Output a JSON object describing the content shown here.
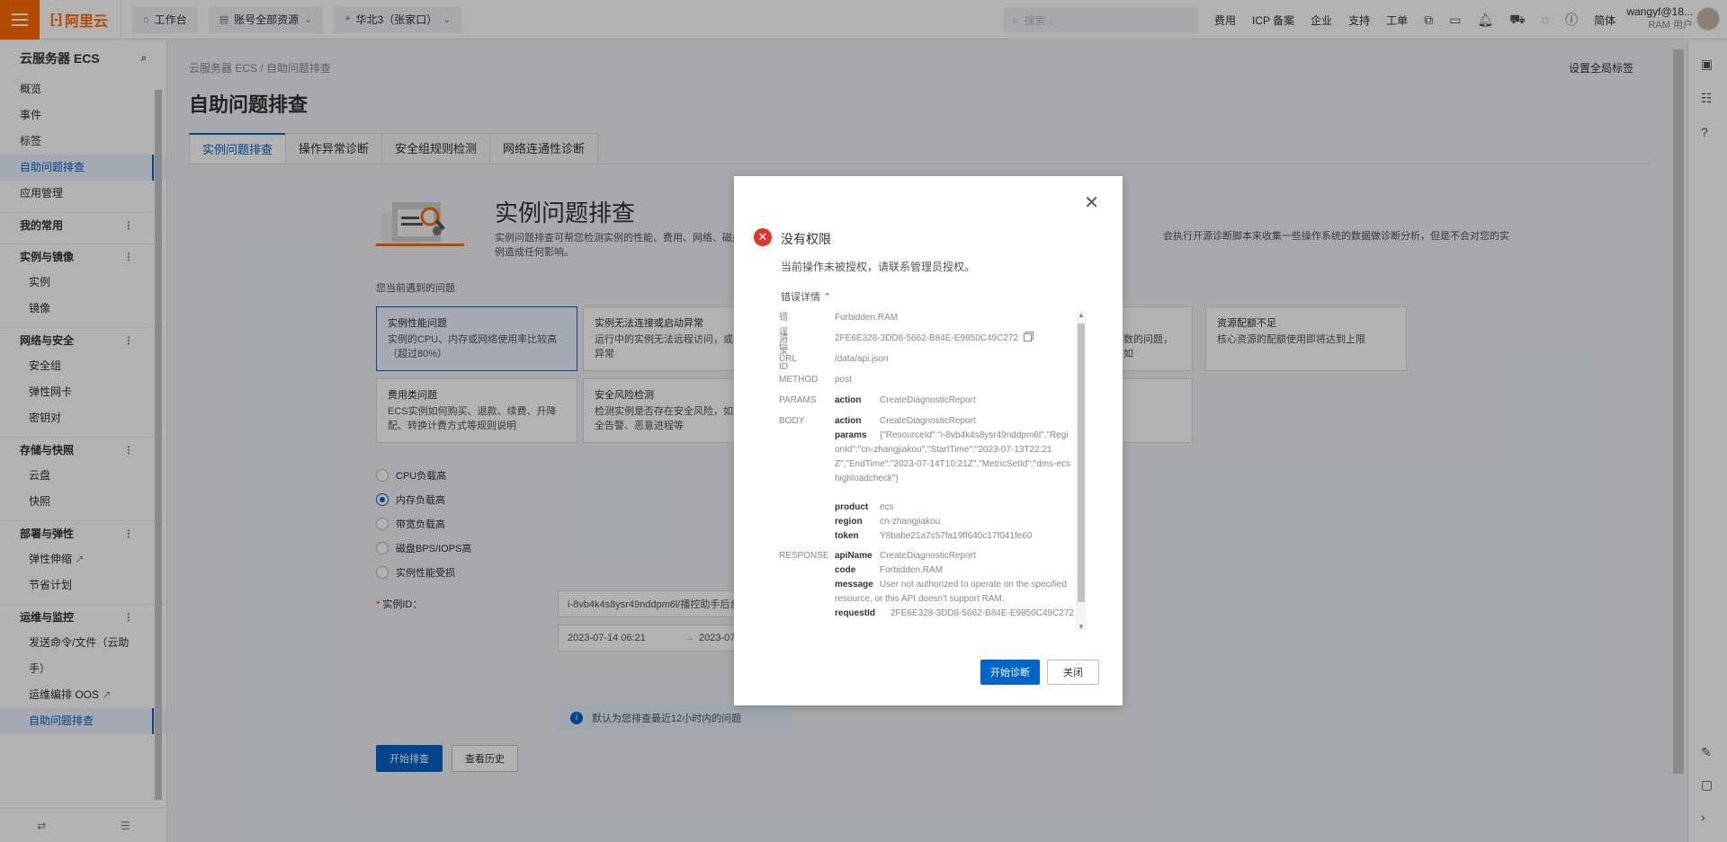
{
  "topbar": {
    "logo": "阿里云",
    "workbench": "工作台",
    "resources": "账号全部资源",
    "region": "华北3（张家口）",
    "search_placeholder": "搜索...",
    "links": [
      "费用",
      "ICP 备案",
      "企业",
      "支持",
      "工单"
    ],
    "lang": "简体",
    "user_name": "wangyf@18...",
    "user_sub": "RAM 用户"
  },
  "sidebar": {
    "title": "云服务器 ECS",
    "top_items": [
      "概览",
      "事件",
      "标签",
      "自助问题排查",
      "应用管理"
    ],
    "groups": [
      {
        "title": "我的常用",
        "items": []
      },
      {
        "title": "实例与镜像",
        "items": [
          "实例",
          "镜像"
        ]
      },
      {
        "title": "网络与安全",
        "items": [
          "安全组",
          "弹性网卡",
          "密钥对"
        ]
      },
      {
        "title": "存储与快照",
        "items": [
          "云盘",
          "快照"
        ]
      },
      {
        "title": "部署与弹性",
        "items": [
          "弹性伸缩",
          "节省计划"
        ]
      },
      {
        "title": "运维与监控",
        "items": [
          "发送命令/文件（云助",
          "手）",
          "运维编排 OOS",
          "自助问题排查"
        ]
      }
    ]
  },
  "content": {
    "breadcrumb": [
      "云服务器 ECS",
      "/",
      "自助问题排查"
    ],
    "global_tag": "设置全局标签",
    "page_title": "自助问题排查",
    "tabs": [
      "实例问题排查",
      "操作异常诊断",
      "安全组规则检测",
      "网络连通性诊断"
    ],
    "hero_title": "实例问题排查",
    "hero_desc": "实例问题排查可帮您检测实例的性能、费用、网络、磁盘",
    "hero_desc_cont": "例造成任何影响。",
    "hero_desc_right": "会执行开源诊断脚本来收集一些操作系统的数据做诊断分析，但是不会对您的实",
    "question_label": "您当前遇到的问题",
    "cards": [
      {
        "title": "实例性能问题",
        "desc": "实例的CPU、内存或网络使用率比较高（超过80%）"
      },
      {
        "title": "实例无法连接或启动异常",
        "desc": "运行中的实例无法远程访问，或实例启动异常"
      },
      {
        "title": "",
        "desc": "数的问题，如"
      },
      {
        "title": "资源配额不足",
        "desc": "核心资源的配额使用即将达到上限"
      },
      {
        "title": "费用类问题",
        "desc": "ECS实例如何购买、退款、续费、升降配、转换计费方式等规则说明"
      },
      {
        "title": "安全风险检测",
        "desc": "检测实例是否存在安全风险，如漏洞、安全告警、恶意进程等"
      }
    ],
    "radios": [
      "CPU负载高",
      "内存负载高",
      "带宽负载高",
      "磁盘BPS/IOPS高",
      "实例性能受损"
    ],
    "instance_label": "实例ID：",
    "instance_value": "i-8vb4k4s8ysr49nddpm6l/播控助手后台",
    "start_time": "2023-07-14 06:21",
    "end_time": "2023-07-",
    "notice": "默认为您排查最近12小时内的问题",
    "start_button": "开始排查",
    "history_button": "查看历史"
  },
  "dialog": {
    "title": "没有权限",
    "message": "当前操作未被授权，请联系管理员授权。",
    "detail_toggle": "错误详情",
    "labels": {
      "code": "错误码",
      "request_id": "请求 ID",
      "url": "URL",
      "method": "METHOD",
      "params": "PARAMS",
      "body": "BODY",
      "response": "RESPONSE"
    },
    "code": "Forbidden.RAM",
    "request_id": "2FE6E328-3DD8-5662-B84E-E9850C49C272",
    "url": "/data/api.json",
    "method": "post",
    "params": [
      {
        "k": "action",
        "v": "CreateDiagnosticReport"
      }
    ],
    "body": [
      {
        "k": "action",
        "v": "CreateDiagnosticReport"
      },
      {
        "k": "params",
        "v": "{\"ResourceId\":\"i-8vb4k4s8ysr49nddpm6l\",\"RegionId\":\"cn-zhangjiakou\",\"StartTime\":\"2023-07-13T22:21Z\",\"EndTime\":\"2023-07-14T10:21Z\",\"MetricSetId\":\"dms-ecshighloadcheck\"}"
      },
      {
        "k": "product",
        "v": "ecs"
      },
      {
        "k": "region",
        "v": "cn-zhangjiakou"
      },
      {
        "k": "token",
        "v": "Y8babe21a7c57fa19ff640c17f041fe60"
      }
    ],
    "response": [
      {
        "k": "apiName",
        "v": "CreateDiagnosticReport"
      },
      {
        "k": "code",
        "v": "Forbidden.RAM"
      },
      {
        "k": "message",
        "v": "User not authorized to operate on the specified resource, or this API doesn't support RAM."
      },
      {
        "k": "requestId",
        "v": "2FE6E328-3DD8-5662-B84E-E9850C49C272"
      }
    ],
    "primary_button": "开始诊断",
    "close_button": "关闭"
  },
  "colors": {
    "brand": "#ff6a00",
    "primary": "#0064c8",
    "error": "#e5322d"
  }
}
